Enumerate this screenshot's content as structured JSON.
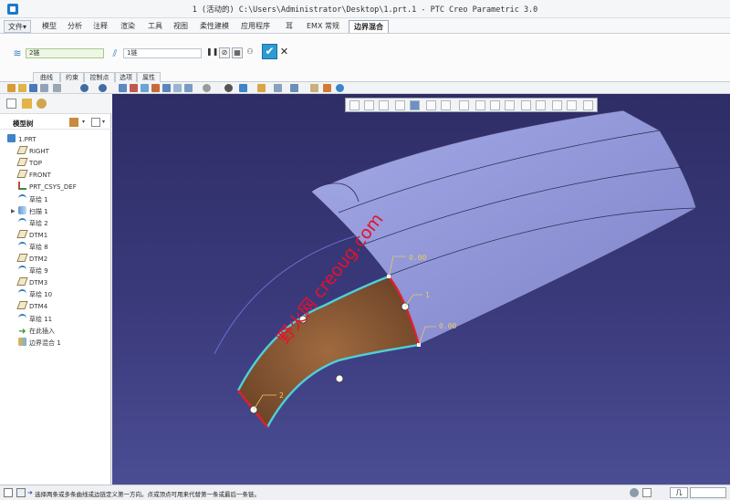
{
  "window": {
    "title": "1 (活动的) C:\\Users\\Administrator\\Desktop\\1.prt.1 - PTC Creo Parametric 3.0"
  },
  "menu": {
    "file": "文件▾",
    "tabs": [
      "模型",
      "分析",
      "注释",
      "渲染",
      "工具",
      "视图",
      "柔性建模",
      "应用程序",
      "耳",
      "EMX 常规"
    ],
    "active_tab": "边界混合"
  },
  "ribbon": {
    "first_direction_value": "2链",
    "second_direction_value": "1链",
    "sub_tabs": [
      "曲线",
      "约束",
      "控制点",
      "选项",
      "属性"
    ],
    "ok_label": "✔",
    "cancel_label": "✕"
  },
  "model_tree": {
    "title": "模型树",
    "items": [
      {
        "label": "1.PRT",
        "icon": "part-icon"
      },
      {
        "label": "RIGHT",
        "icon": "datum-plane-icon"
      },
      {
        "label": "TOP",
        "icon": "datum-plane-icon"
      },
      {
        "label": "FRONT",
        "icon": "datum-plane-icon"
      },
      {
        "label": "PRT_CSYS_DEF",
        "icon": "csys-icon"
      },
      {
        "label": "草绘 1",
        "icon": "sketch-icon"
      },
      {
        "label": "扫描 1",
        "icon": "sweep-icon"
      },
      {
        "label": "草绘 2",
        "icon": "sketch-icon"
      },
      {
        "label": "DTM1",
        "icon": "datum-plane-icon"
      },
      {
        "label": "草绘 8",
        "icon": "sketch-icon"
      },
      {
        "label": "DTM2",
        "icon": "datum-plane-icon"
      },
      {
        "label": "草绘 9",
        "icon": "sketch-icon"
      },
      {
        "label": "DTM3",
        "icon": "datum-plane-icon"
      },
      {
        "label": "草绘 10",
        "icon": "sketch-icon"
      },
      {
        "label": "DTM4",
        "icon": "datum-plane-icon"
      },
      {
        "label": "草绘 11",
        "icon": "sketch-icon"
      },
      {
        "label": "在此插入",
        "icon": "insert-here-icon"
      },
      {
        "label": "边界混合 1",
        "icon": "boundary-blend-icon"
      }
    ]
  },
  "viewport": {
    "annotations": {
      "top_constraint": "0.00",
      "right_constraint": "0.00",
      "label_one": "1",
      "label_two": "2"
    },
    "watermark": "野火网 creoug.com"
  },
  "status": {
    "message": "选择两条或多条曲线或边链定义第一方向。点或顶点可用来代替第一条或最后一条链。",
    "filter_label": "几"
  },
  "colors": {
    "viewport_top": "#2f2d66",
    "surface_fill": "#8f96d6",
    "blend_fill": "#7a4e2f",
    "edge_cyan": "#4fd0d8",
    "edge_red": "#e0202a",
    "watermark": "#e8102a"
  }
}
